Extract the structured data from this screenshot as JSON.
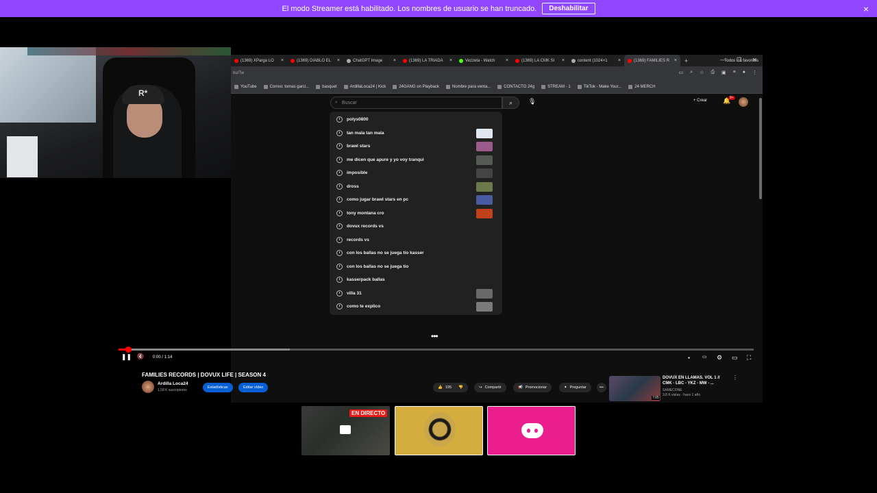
{
  "banner": {
    "message": "El modo Streamer está habilitado. Los nombres de usuario se han truncado.",
    "button_label": "Deshabilitar",
    "close_icon": "×"
  },
  "browser": {
    "tabs": [
      {
        "label": "(1369) XParga LO",
        "color": "#ff0000"
      },
      {
        "label": "(1369) DIABLO EL",
        "color": "#ff0000"
      },
      {
        "label": "ChatGPT Image",
        "color": "#aaaaaa"
      },
      {
        "label": "(1369) LA TRIADA",
        "color": "#ff0000"
      },
      {
        "label": "Vezzeta - Watch",
        "color": "#53fc18"
      },
      {
        "label": "(1369) LA CMK SI",
        "color": "#ff0000"
      },
      {
        "label": "content (1024×1",
        "color": "#aaaaaa"
      },
      {
        "label": "(1369) FAMILIES R",
        "color": "#ff0000"
      }
    ],
    "url": "bu/Tw",
    "bookmarks": [
      "YouTube",
      "Correo: tomas garci...",
      "basquet",
      "ArdillaLoca24 | Kick",
      "24GANG on Playback",
      "Nombre para venta...",
      "CONTACTO 24g",
      "STREAM - 1",
      "TikTok - Make Your...",
      "24 MERCH"
    ],
    "bookmarks_all": "Todos los favoritos"
  },
  "youtube": {
    "search_placeholder": "Buscar",
    "create_label": "+ Crear",
    "notif_count": "9+",
    "suggestions": [
      {
        "text": "polys0800",
        "thumb": null
      },
      {
        "text": "tan mala tan mala",
        "thumb": "#dfe8ef"
      },
      {
        "text": "brawl stars",
        "thumb": "#9a5a8a"
      },
      {
        "text": "me dicen que apure y yo voy tranqui",
        "thumb": "#555a55"
      },
      {
        "text": "imposible",
        "thumb": "#444"
      },
      {
        "text": "dross",
        "thumb": "#6a7a4a"
      },
      {
        "text": "como jugar brawl stars en pc",
        "thumb": "#4a5aa0"
      },
      {
        "text": "tony montana cro",
        "thumb": "#c0401a"
      },
      {
        "text": "dovux records vs",
        "thumb": null
      },
      {
        "text": "records vs",
        "thumb": null
      },
      {
        "text": "con los ballas no se juega tio kasser",
        "thumb": null
      },
      {
        "text": "con los ballas no se juega tio",
        "thumb": null
      },
      {
        "text": "kasserpack ballas",
        "thumb": null
      },
      {
        "text": "villa 31",
        "thumb": "#6a6a6a"
      },
      {
        "text": "como te explico",
        "thumb": "#7a7a7a"
      }
    ],
    "player": {
      "time": "0:00 / 1:14",
      "progress": 0.015,
      "buffered": 0.27
    },
    "video": {
      "title": "FAMILIES RECORDS | DOVUX LIFE | SEASON 4",
      "channel": "Ardilla Loca24",
      "subs": "1,58 K suscriptores",
      "stats_label": "Estadísticas",
      "edit_label": "Editar vídeo",
      "likes": "195",
      "share_label": "Compartir",
      "promote_label": "Promocionar",
      "ask_label": "Preguntar"
    },
    "recommended": {
      "title": "DOVUX EN LLAMAS. VOL 1 // CMK - LBC - YKZ - MW - ...",
      "channel": "SAMECONE",
      "meta": "3,8 K vistas · hace 1 año",
      "duration": "7:05"
    }
  },
  "overlay": {
    "live_label": "EN DIRECTO"
  }
}
